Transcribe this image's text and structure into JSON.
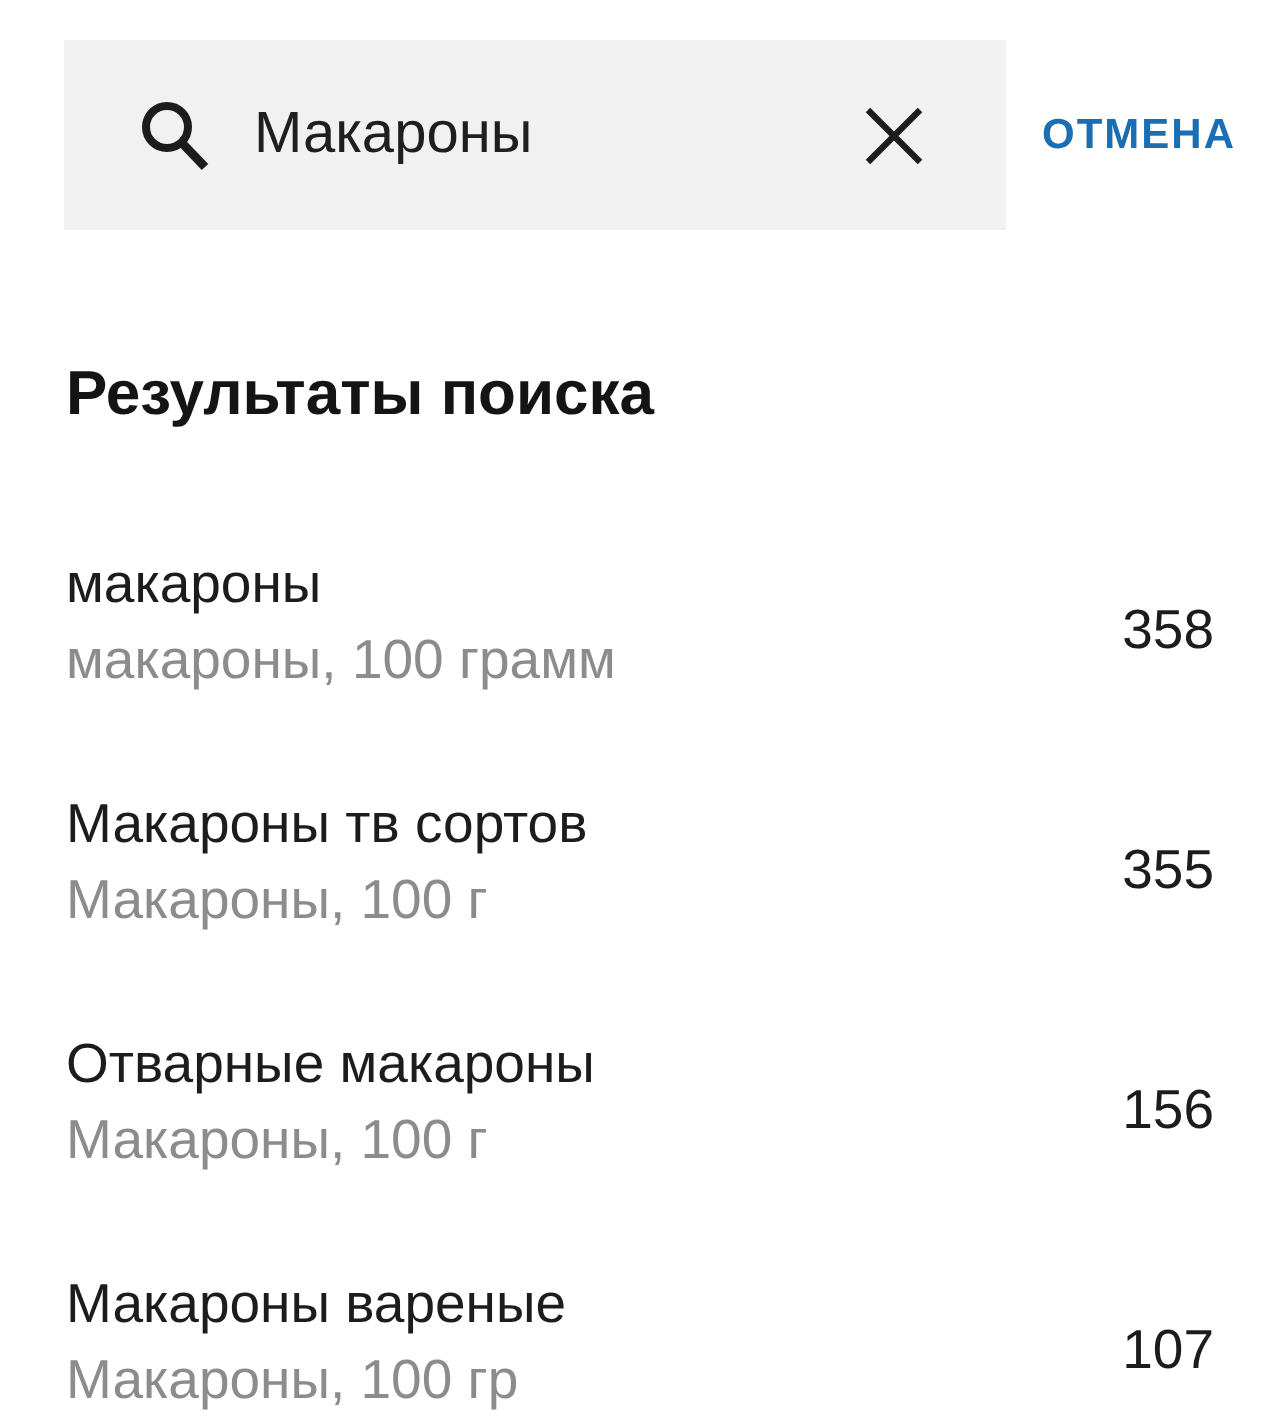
{
  "search": {
    "value": "Макароны",
    "cancel": "ОТМЕНА"
  },
  "results": {
    "title": "Результаты поиска",
    "items": [
      {
        "name": "макароны",
        "detail": "макароны, 100 грамм",
        "calories": "358"
      },
      {
        "name": "Макароны тв сортов",
        "detail": "Макароны, 100 г",
        "calories": "355"
      },
      {
        "name": "Отварные макароны",
        "detail": "Макароны, 100 г",
        "calories": "156"
      },
      {
        "name": "Макароны вареные",
        "detail": "Макароны, 100 гр",
        "calories": "107"
      }
    ]
  }
}
